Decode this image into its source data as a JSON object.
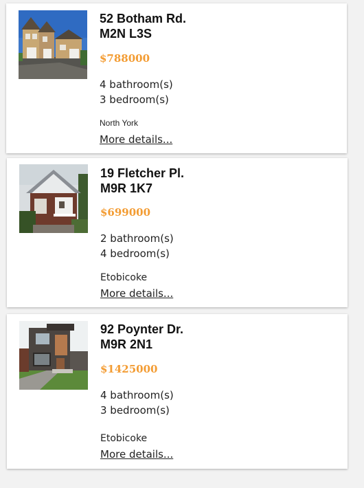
{
  "listings": [
    {
      "address_line1": "52 Botham Rd.",
      "address_line2": "M2N L3S",
      "price": "$788000",
      "bathrooms": "4 bathroom(s)",
      "bedrooms": "3 bedroom(s)",
      "area": "North York",
      "more_label": "More details...",
      "photo_icon": "house-photo-brick"
    },
    {
      "address_line1": "19 Fletcher Pl.",
      "address_line2": "M9R 1K7",
      "price": "$699000",
      "bathrooms": "2 bathroom(s)",
      "bedrooms": "4 bedroom(s)",
      "area": "Etobicoke",
      "more_label": "More details...",
      "photo_icon": "house-photo-bungalow"
    },
    {
      "address_line1": "92 Poynter Dr.",
      "address_line2": "M9R 2N1",
      "price": "$1425000",
      "bathrooms": "4 bathroom(s)",
      "bedrooms": "3 bedroom(s)",
      "area": "Etobicoke",
      "more_label": "More details...",
      "photo_icon": "house-photo-modern"
    }
  ],
  "colors": {
    "price": "#f39c33",
    "background": "#f2f2f2",
    "card": "#ffffff"
  }
}
